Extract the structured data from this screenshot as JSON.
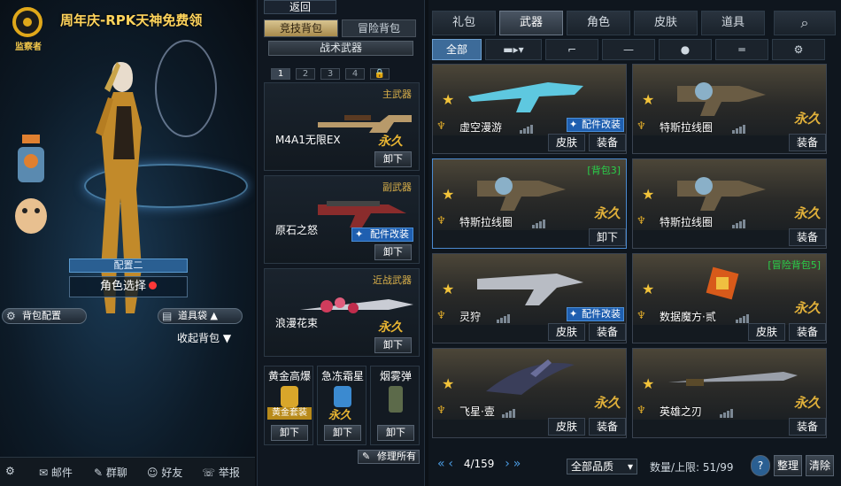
{
  "left": {
    "logo_text": "监察者",
    "promo": "周年庆-RPK天神免费领",
    "config_label": "配置二",
    "role_select": "角色选择",
    "bag_config": "背包配置",
    "item_bag": "道具袋",
    "collapse_bag": "收起背包",
    "bottom": [
      "邮件",
      "群聊",
      "好友",
      "举报"
    ]
  },
  "middle": {
    "back": "返回",
    "bag_tabs": [
      "竞技背包",
      "冒险背包"
    ],
    "tactical": "战术武器",
    "slot_nums": [
      "1",
      "2",
      "3",
      "4"
    ],
    "slots": [
      {
        "category": "主武器",
        "name": "M4A1无限EX",
        "perm": "永久",
        "unload": "卸下"
      },
      {
        "category": "副武器",
        "name": "原石之怒",
        "mod": "配件改装",
        "unload": "卸下"
      },
      {
        "category": "近战武器",
        "name": "浪漫花束",
        "perm": "永久",
        "unload": "卸下"
      }
    ],
    "throwables": [
      {
        "name": "黄金高爆",
        "tag": "黄金套装",
        "unload": "卸下"
      },
      {
        "name": "急冻霜星",
        "tag": "永久",
        "unload": "卸下"
      },
      {
        "name": "烟雾弹",
        "unload": "卸下"
      }
    ],
    "repair_all": "修理所有"
  },
  "right": {
    "categories": [
      "礼包",
      "武器",
      "角色",
      "皮肤",
      "道具"
    ],
    "active_category": "武器",
    "subtab_all": "全部",
    "cards": [
      {
        "name": "虚空漫游",
        "mod": "配件改装",
        "skin": "皮肤",
        "equip": "装备"
      },
      {
        "name": "特斯拉线圈",
        "perm": "永久",
        "equip": "装备"
      },
      {
        "name": "特斯拉线圈",
        "perm": "永久",
        "bag": "[背包3]",
        "unload": "卸下"
      },
      {
        "name": "特斯拉线圈",
        "perm": "永久",
        "equip": "装备"
      },
      {
        "name": "灵狩",
        "mod": "配件改装",
        "skin": "皮肤",
        "equip": "装备"
      },
      {
        "name": "数据魔方·贰",
        "perm": "永久",
        "bag": "[冒险背包5]",
        "skin": "皮肤",
        "equip": "装备"
      },
      {
        "name": "飞星·壹",
        "perm": "永久",
        "skin": "皮肤",
        "equip": "装备"
      },
      {
        "name": "英雄之刃",
        "perm": "永久",
        "equip": "装备"
      }
    ],
    "page": "4/159",
    "quality": "全部品质",
    "capacity_label": "数量/上限: 51/99",
    "help": "?",
    "sort": "整理",
    "clear": "清除"
  },
  "colors": {
    "gold": "#e8b532",
    "accent_blue": "#1f5fb0",
    "bag_green": "#29d04a"
  }
}
